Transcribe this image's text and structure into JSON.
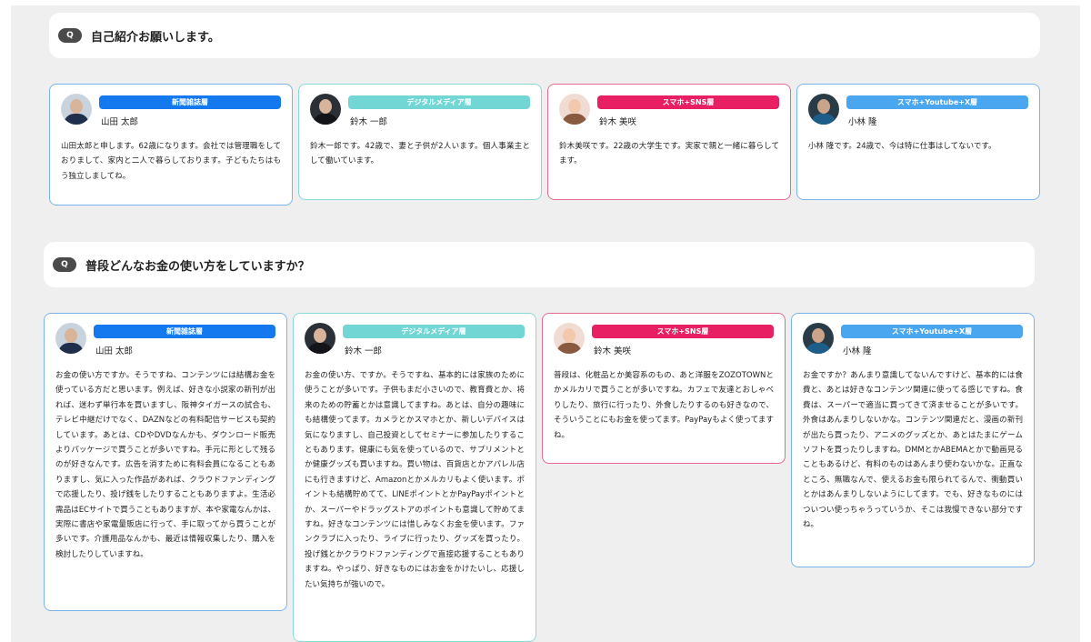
{
  "colors": {
    "newspaper": "#1479ee",
    "digital": "#72d6d4",
    "sns": "#e81f63",
    "youtube": "#4aa6ef"
  },
  "questions": [
    {
      "badge": "Q",
      "text": "自己紹介お願いします。",
      "answers": [
        {
          "tag": "新聞雑誌層",
          "name": "山田 太郎",
          "avatar": "person-avatar",
          "text": "山田太郎と申します。62歳になります。会社では管理職をしておりまして、家内と二人で暮らしております。子どもたちはもう独立しましてね。"
        },
        {
          "tag": "デジタルメディア層",
          "name": "鈴木 一郎",
          "avatar": "person-avatar",
          "text": "鈴木一郎です。42歳で、妻と子供が2人います。個人事業主として働いています。"
        },
        {
          "tag": "スマホ+SNS層",
          "name": "鈴木 美咲",
          "avatar": "person-avatar",
          "text": "鈴木美咲です。22歳の大学生です。実家で親と一緒に暮らしてます。"
        },
        {
          "tag": "スマホ+Youtube+X層",
          "name": "小林 隆",
          "avatar": "person-avatar",
          "text": "小林 隆です。24歳で、今は特に仕事はしてないです。"
        }
      ]
    },
    {
      "badge": "Q",
      "text": "普段どんなお金の使い方をしていますか？",
      "answers": [
        {
          "tag": "新聞雑誌層",
          "name": "山田 太郎",
          "avatar": "person-avatar",
          "text": "お金の使い方ですか。そうですね、コンテンツには結構お金を使っている方だと思います。例えば、好きな小説家の新刊が出れば、迷わず単行本を買いますし、阪神タイガースの試合も、テレビ中継だけでなく、DAZNなどの有料配信サービスも契約しています。あとは、CDやDVDなんかも、ダウンロード販売よりパッケージで買うことが多いですね。手元に形として残るのが好きなんです。広告を消すために有料会員になることもありますし、気に入った作品があれば、クラウドファンディングで応援したり、投げ銭をしたりすることもありますよ。生活必需品はECサイトで買うこともありますが、本や家電なんかは、実際に書店や家電量販店に行って、手に取ってから買うことが多いです。介護用品なんかも、最近は情報収集したり、購入を検討したりしていますね。"
        },
        {
          "tag": "デジタルメディア層",
          "name": "鈴木 一郎",
          "avatar": "person-avatar",
          "text": "お金の使い方、ですか。そうですね、基本的には家族のために使うことが多いです。子供もまだ小さいので、教育費とか、将来のための貯蓄とかは意識してますね。あとは、自分の趣味にも結構使ってます。カメラとかスマホとか、新しいデバイスは気になりますし、自己投資としてセミナーに参加したりすることもあります。健康にも気を使っているので、サプリメントとか健康グッズも買いますね。買い物は、百貨店とかアパレル店にも行きますけど、Amazonとかメルカリもよく使います。ポイントも結構貯めてて、LINEポイントとかPayPayポイントとか、スーパーやドラッグストアのポイントも意識して貯めてますね。好きなコンテンツには惜しみなくお金を使います。ファンクラブに入ったり、ライブに行ったり、グッズを買ったり。投げ銭とかクラウドファンディングで直接応援することもありますね。やっぱり、好きなものにはお金をかけたいし、応援したい気持ちが強いので。"
        },
        {
          "tag": "スマホ+SNS層",
          "name": "鈴木 美咲",
          "avatar": "person-avatar",
          "text": "普段は、化粧品とか美容系のもの、あと洋服をZOZOTOWNとかメルカリで買うことが多いですね。カフェで友達とおしゃべりしたり、旅行に行ったり、外食したりするのも好きなので、そういうことにもお金を使ってます。PayPayもよく使ってますね。"
        },
        {
          "tag": "スマホ+Youtube+X層",
          "name": "小林 隆",
          "avatar": "person-avatar",
          "text": "お金ですか？あんまり意識してないんですけど、基本的には食費と、あとは好きなコンテンツ関連に使ってる感じですね。食費は、スーパーで適当に買ってきて済ませることが多いです。外食はあんまりしないかな。コンテンツ関連だと、漫画の新刊が出たら買ったり、アニメのグッズとか、あとはたまにゲームソフトを買ったりしますね。DMMとかABEMAとかで動画見ることもあるけど、有料のものはあんまり使わないかな。正直なところ、無職なんで、使えるお金も限られてるんで、衝動買いとかはあんまりしないようにしてます。でも、好きなものにはついつい使っちゃうっていうか、そこは我慢できない部分ですね。"
        }
      ]
    }
  ]
}
